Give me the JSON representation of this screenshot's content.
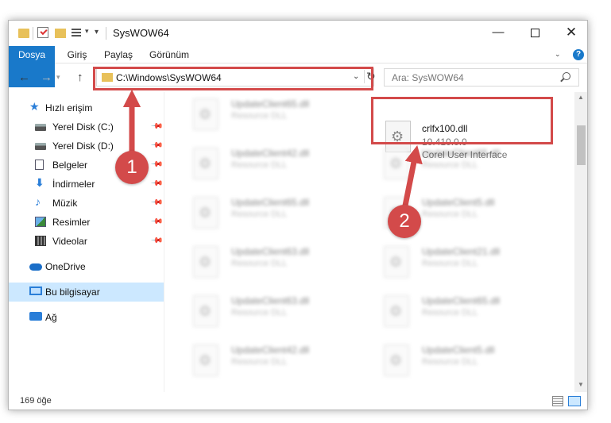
{
  "window": {
    "title": "SysWOW64",
    "minimize": "—",
    "close": "✕"
  },
  "ribbon": {
    "tabs": [
      "Dosya",
      "Giriş",
      "Paylaş",
      "Görünüm"
    ],
    "help": "?"
  },
  "nav": {
    "address": "C:\\Windows\\SysWOW64",
    "search_placeholder": "Ara: SysWOW64"
  },
  "sidebar": {
    "items": [
      {
        "label": "Hızlı erişim",
        "icon": "star-icon"
      },
      {
        "label": "Yerel Disk (C:)",
        "icon": "drive-icon"
      },
      {
        "label": "Yerel Disk (D:)",
        "icon": "drive-icon"
      },
      {
        "label": "Belgeler",
        "icon": "document-icon"
      },
      {
        "label": "İndirmeler",
        "icon": "download-icon"
      },
      {
        "label": "Müzik",
        "icon": "music-icon"
      },
      {
        "label": "Resimler",
        "icon": "pictures-icon"
      },
      {
        "label": "Videolar",
        "icon": "video-icon"
      },
      {
        "label": "OneDrive",
        "icon": "cloud-icon"
      },
      {
        "label": "Bu bilgisayar",
        "icon": "computer-icon"
      },
      {
        "label": "Ağ",
        "icon": "network-icon"
      }
    ]
  },
  "files": {
    "target": {
      "name": "crlfx100.dll",
      "version": "10.410.0.0",
      "description": "Corel User Interface"
    },
    "left_column": [
      {
        "name": "UpdateClient65.dll",
        "type": "Resource DLL"
      },
      {
        "name": "UpdateClient42.dll",
        "type": "Resource DLL"
      },
      {
        "name": "UpdateClient65.dll",
        "type": "Resource DLL"
      },
      {
        "name": "UpdateClient63.dll",
        "type": "Resource DLL"
      },
      {
        "name": "UpdateClient63.dll",
        "type": "Resource DLL"
      },
      {
        "name": "UpdateClient42.dll",
        "type": "Resource DLL"
      }
    ],
    "right_column": [
      {
        "name": "UpdateClient65.dll",
        "type": "Resource DLL"
      },
      {
        "name": "UpdateClient5.dll",
        "type": "Resource DLL"
      },
      {
        "name": "UpdateClient21.dll",
        "type": "Resource DLL"
      },
      {
        "name": "UpdateClient65.dll",
        "type": "Resource DLL"
      },
      {
        "name": "UpdateClient5.dll",
        "type": "Resource DLL"
      }
    ]
  },
  "status": {
    "count": "169 öğe"
  },
  "annotations": {
    "badge_1": "1",
    "badge_2": "2",
    "color": "#d34a4a"
  }
}
